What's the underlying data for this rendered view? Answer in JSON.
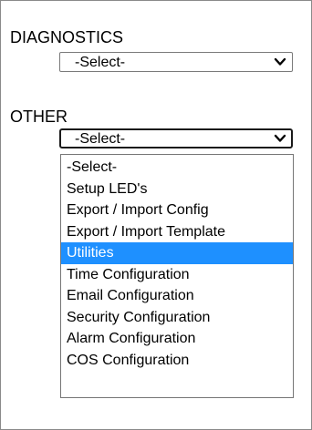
{
  "diagnostics": {
    "label": "DIAGNOSTICS",
    "selected": "-Select-"
  },
  "other": {
    "label": "OTHER",
    "selected": "-Select-",
    "options": [
      "-Select-",
      "Setup LED's",
      "Export / Import Config",
      "Export / Import Template",
      "Utilities",
      "Time Configuration",
      "Email Configuration",
      "Security Configuration",
      "Alarm Configuration",
      "COS Configuration"
    ],
    "highlighted": "Utilities"
  },
  "colors": {
    "highlight": "#1e90ff",
    "border": "#7a7a7a"
  }
}
